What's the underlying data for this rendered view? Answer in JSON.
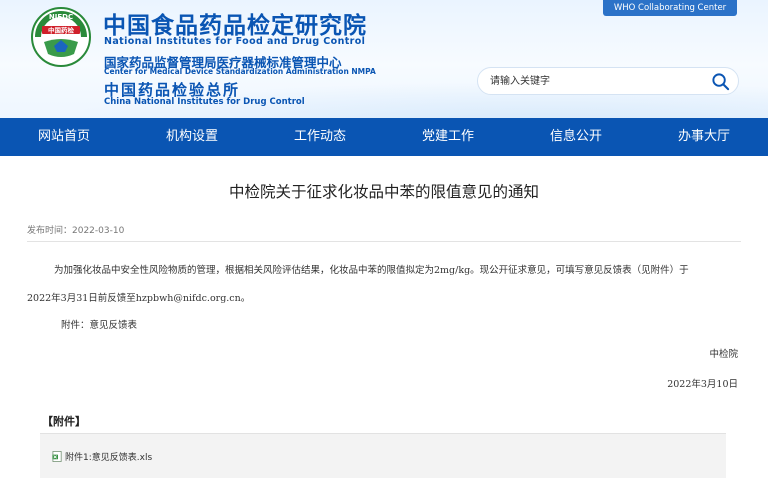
{
  "header": {
    "logo_text": "中国药检",
    "logo_arc_text": "NIFDC",
    "title_cn": "中国食品药品检定研究院",
    "title_en": "National Institutes for Food and Drug Control",
    "sub1_cn": "国家药品监督管理局医疗器械标准管理中心",
    "sub1_en": "Center for Medical Device Standardization Administration NMPA",
    "sub2_cn": "中国药品检验总所",
    "sub2_en": "China National Institutes for Drug Control",
    "who_label": "WHO Collaborating Center"
  },
  "search": {
    "placeholder": "请输入关键字",
    "icon": "search-icon"
  },
  "nav": {
    "items": [
      {
        "label": "网站首页"
      },
      {
        "label": "机构设置"
      },
      {
        "label": "工作动态"
      },
      {
        "label": "党建工作"
      },
      {
        "label": "信息公开"
      },
      {
        "label": "办事大厅"
      }
    ]
  },
  "article": {
    "title": "中检院关于征求化妆品中苯的限值意见的通知",
    "meta": "发布时间：2022-03-10",
    "para1": "为加强化妆品中安全性风险物质的管理，根据相关风险评估结果，化妆品中苯的限值拟定为2mg/kg。现公开征求意见，可填写意见反馈表（见附件）于",
    "para2": "2022年3月31日前反馈至hzpbwh@nifdc.org.cn。",
    "para3": "附件：意见反馈表",
    "signature": "中检院",
    "date": "2022年3月10日"
  },
  "attachments": {
    "heading": "【附件】",
    "files": [
      {
        "label": "附件1:意见反馈表.xls",
        "icon": "xls-file-icon"
      }
    ]
  },
  "colors": {
    "brand_blue": "#0a55b3",
    "who_blue": "#2b72c8"
  }
}
